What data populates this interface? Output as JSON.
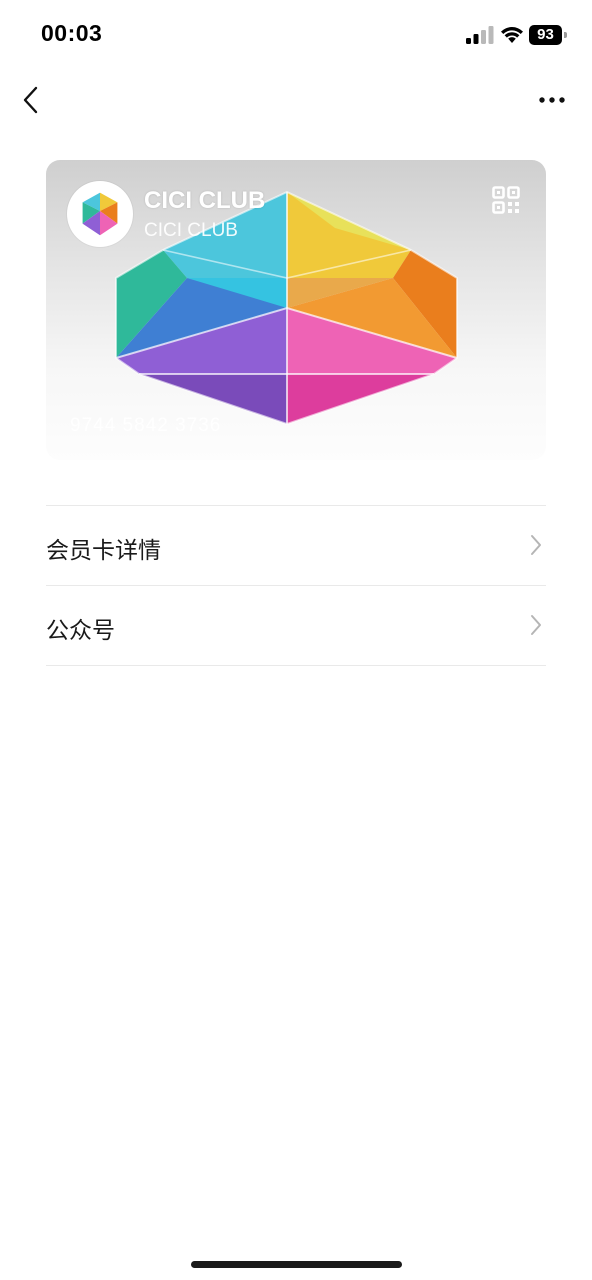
{
  "status_bar": {
    "time": "00:03",
    "battery": "93",
    "icons": [
      "signal-icon",
      "wifi-icon",
      "battery-icon"
    ]
  },
  "nav": {
    "back_icon": "chevron-left-icon",
    "more_icon": "more-dots-icon"
  },
  "card": {
    "title": "CICI CLUB",
    "subtitle": "CICI CLUB",
    "number": "9744 5842 3736",
    "qr_icon": "qr-code-icon"
  },
  "list": {
    "items": [
      {
        "label": "会员卡详情"
      },
      {
        "label": "公众号"
      }
    ]
  },
  "colors": {
    "background": "#ffffff",
    "divider": "#e9e9e9",
    "chevron": "#b5b5b5"
  }
}
